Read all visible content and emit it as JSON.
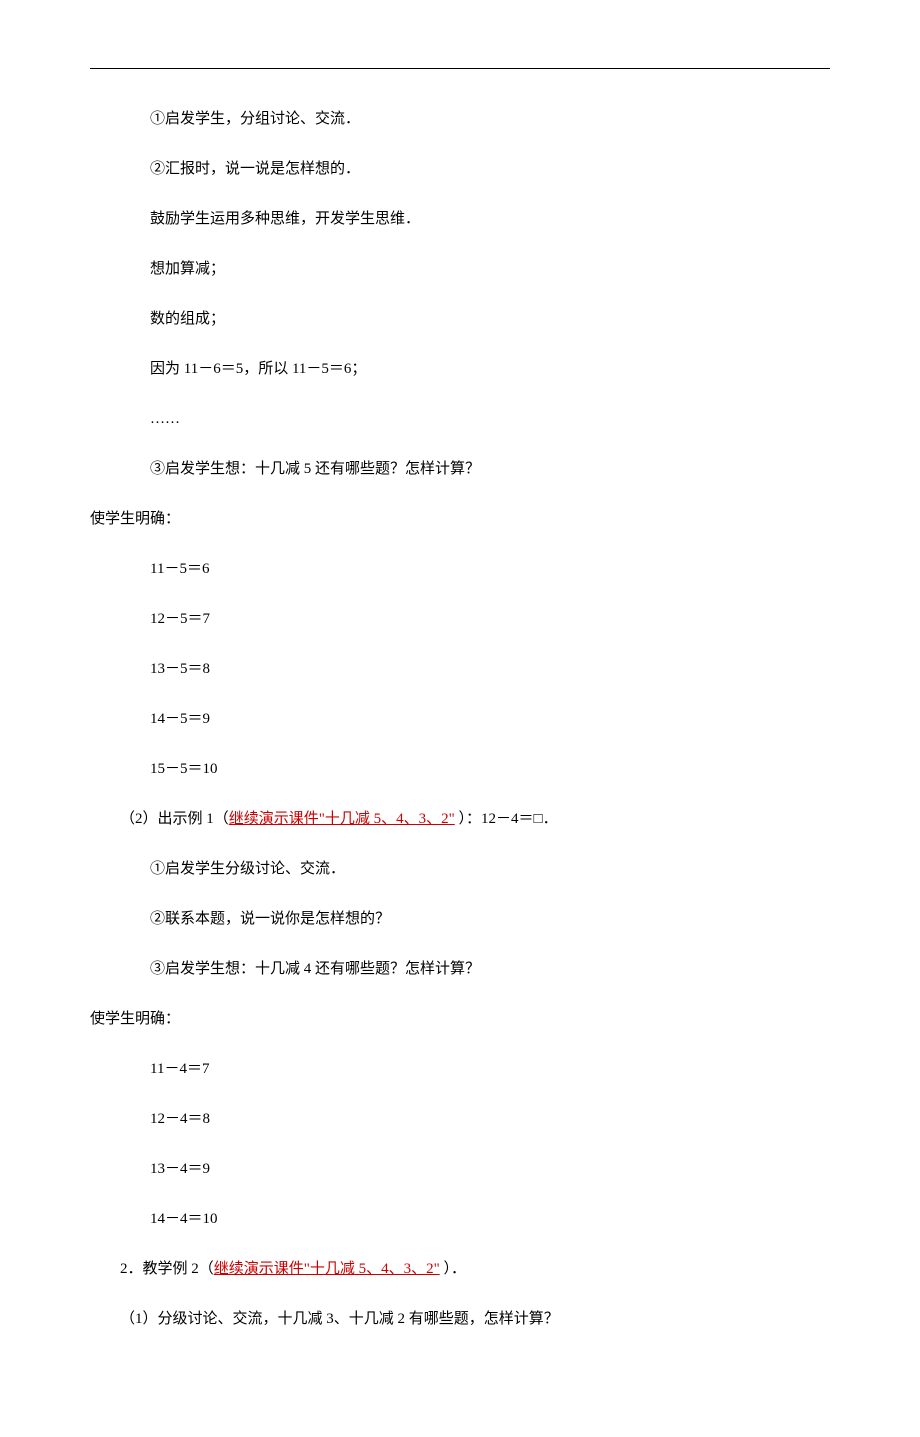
{
  "lines": {
    "l1": "①启发学生，分组讨论、交流．",
    "l2": "②汇报时，说一说是怎样想的．",
    "l3": "鼓励学生运用多种思维，开发学生思维．",
    "l4": "想加算减；",
    "l5": "数的组成；",
    "l6": "因为 11－6＝5，所以 11－5＝6；",
    "l7": "……",
    "l8": "③启发学生想：十几减 5 还有哪些题？怎样计算？",
    "l9": "使学生明确：",
    "l10": "11－5＝6",
    "l11": "12－5＝7",
    "l12": "13－5＝8",
    "l13": "14－5＝9",
    "l14": "15－5＝10",
    "l15a": "（2）出示例 1（",
    "l15b": "继续演示课件\"十几减 5、4、3、2\"",
    "l15c": "  ）：12－4＝□．",
    "l16": "①启发学生分级讨论、交流．",
    "l17": "②联系本题，说一说你是怎样想的？",
    "l18": "③启发学生想：十几减 4 还有哪些题？怎样计算？",
    "l19": "使学生明确：",
    "l20": "11－4＝7",
    "l21": "12－4＝8",
    "l22": "13－4＝9",
    "l23": "14－4＝10",
    "l24a": "2．教学例 2（",
    "l24b": "继续演示课件\"十几减 5、4、3、2\"",
    "l24c": "  ）．",
    "l25": "（1）分级讨论、交流，十几减 3、十几减 2 有哪些题，怎样计算？"
  }
}
